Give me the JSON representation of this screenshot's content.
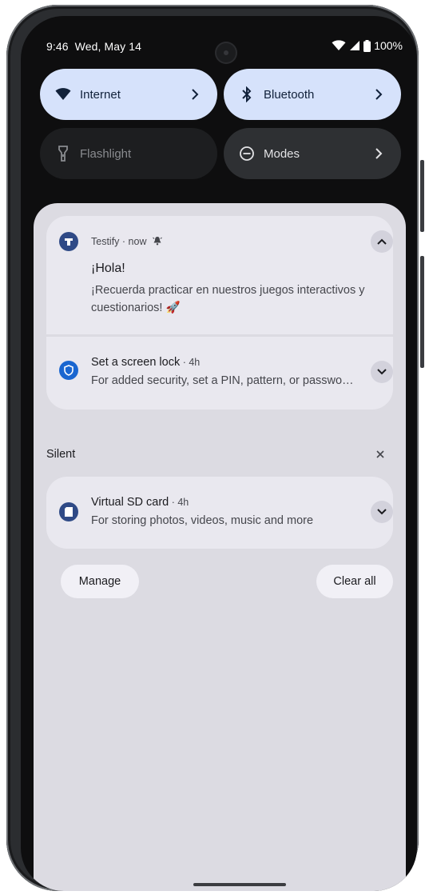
{
  "status_bar": {
    "time": "9:46",
    "date": "Wed, May 14",
    "battery": "100%"
  },
  "quick_settings": [
    {
      "label": "Internet",
      "icon": "wifi-icon",
      "state": "on"
    },
    {
      "label": "Bluetooth",
      "icon": "bluetooth-icon",
      "state": "on"
    },
    {
      "label": "Flashlight",
      "icon": "flashlight-icon",
      "state": "off"
    },
    {
      "label": "Modes",
      "icon": "modes-icon",
      "state": "neutral"
    }
  ],
  "notifications": {
    "testify": {
      "app": "Testify",
      "time": "now",
      "title": "¡Hola!",
      "body": "¡Recuerda practicar en nuestros juegos interactivos y cuestionarios! 🚀"
    },
    "screen_lock": {
      "title": "Set a screen lock",
      "time": "4h",
      "body": "For added security, set a PIN, pattern, or passwo…"
    },
    "silent_header": "Silent",
    "sd_card": {
      "title": "Virtual SD card",
      "time": "4h",
      "body": "For storing photos, videos, music and more"
    }
  },
  "actions": {
    "manage": "Manage",
    "clear_all": "Clear all"
  },
  "colors": {
    "tile_on": "#d6e2fb",
    "shade_bg": "#dcdbe2",
    "card_bg": "#e9e8ef",
    "app_icon": "#2f4a86",
    "lock_icon": "#1a66d0"
  }
}
